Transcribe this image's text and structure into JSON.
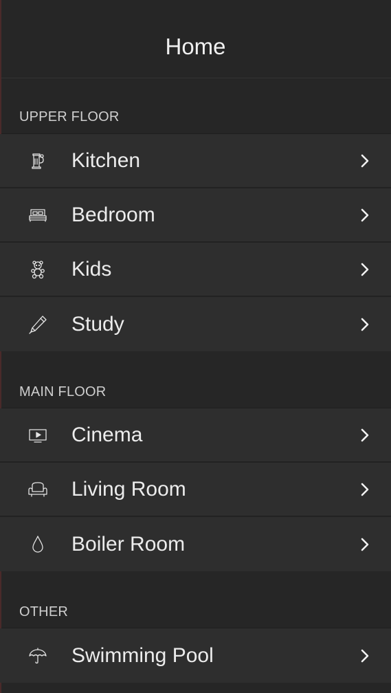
{
  "header": {
    "title": "Home"
  },
  "sections": [
    {
      "label": "UPPER FLOOR",
      "items": [
        {
          "label": "Kitchen",
          "icon": "kettle-icon"
        },
        {
          "label": "Bedroom",
          "icon": "bed-icon"
        },
        {
          "label": "Kids",
          "icon": "teddy-bear-icon"
        },
        {
          "label": "Study",
          "icon": "pencil-icon"
        }
      ]
    },
    {
      "label": "MAIN FLOOR",
      "items": [
        {
          "label": "Cinema",
          "icon": "tv-play-icon"
        },
        {
          "label": "Living Room",
          "icon": "armchair-icon"
        },
        {
          "label": "Boiler Room",
          "icon": "water-drop-icon"
        }
      ]
    },
    {
      "label": "OTHER",
      "items": [
        {
          "label": "Swimming Pool",
          "icon": "umbrella-icon"
        }
      ]
    }
  ],
  "colors": {
    "background": "#262626",
    "row": "#2e2e2e",
    "text": "#ececec",
    "section_label": "#cfcfcf"
  }
}
